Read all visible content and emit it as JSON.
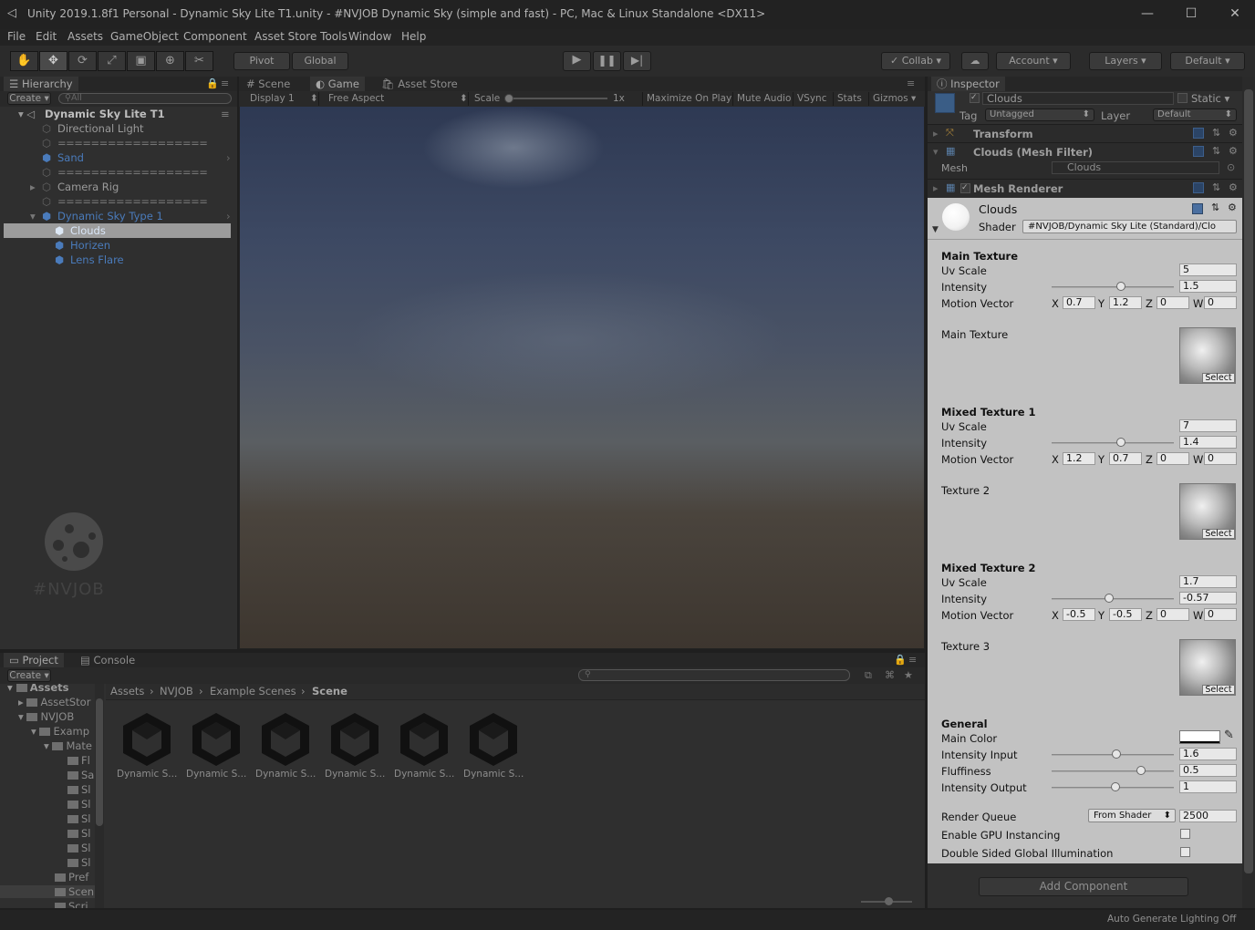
{
  "window": {
    "title": "Unity 2019.1.8f1 Personal - Dynamic Sky Lite T1.unity - #NVJOB Dynamic Sky (simple and fast) - PC, Mac & Linux Standalone <DX11>",
    "minimize": "—",
    "maximize": "☐",
    "close": "✕"
  },
  "menu": [
    "File",
    "Edit",
    "Assets",
    "GameObject",
    "Component",
    "Asset Store Tools",
    "Window",
    "Help"
  ],
  "toolbar": {
    "pivot": "Pivot",
    "global": "Global",
    "collab": "Collab",
    "account": "Account",
    "layers": "Layers",
    "layout": "Default"
  },
  "hierarchy": {
    "tab": "Hierarchy",
    "create": "Create",
    "search_placeholder": "All",
    "scene": "Dynamic Sky Lite T1",
    "items": [
      {
        "label": "Directional Light"
      },
      {
        "label": "=================="
      },
      {
        "label": "Sand"
      },
      {
        "label": "=================="
      },
      {
        "label": "Camera Rig"
      },
      {
        "label": "=================="
      },
      {
        "label": "Dynamic Sky Type 1"
      },
      {
        "label": "Clouds"
      },
      {
        "label": "Horizen"
      },
      {
        "label": "Lens Flare"
      }
    ],
    "watermark": "#NVJOB"
  },
  "game": {
    "tabs": [
      "Scene",
      "Game",
      "Asset Store"
    ],
    "display": "Display 1",
    "aspect": "Free Aspect",
    "scale_label": "Scale",
    "scale_value": "1x",
    "toggles": [
      "Maximize On Play",
      "Mute Audio",
      "VSync",
      "Stats",
      "Gizmos"
    ]
  },
  "project": {
    "tabs": [
      "Project",
      "Console"
    ],
    "create": "Create",
    "tree": [
      "Assets",
      "AssetStor",
      "NVJOB",
      "Examp",
      "Mate",
      "Fl",
      "Sa",
      "Sl",
      "Sl",
      "Sl",
      "Sl",
      "Sl",
      "Sl",
      "Pref",
      "Scen",
      "Scri"
    ],
    "breadcrumb": [
      "Assets",
      "NVJOB",
      "Example Scenes",
      "Scene"
    ],
    "assets": [
      "Dynamic S...",
      "Dynamic S...",
      "Dynamic S...",
      "Dynamic S...",
      "Dynamic S...",
      "Dynamic S..."
    ]
  },
  "inspector": {
    "tab": "Inspector",
    "object_name": "Clouds",
    "static": "Static",
    "tag_label": "Tag",
    "tag_value": "Untagged",
    "layer_label": "Layer",
    "layer_value": "Default",
    "components": {
      "transform": "Transform",
      "mesh_filter": "Clouds (Mesh Filter)",
      "mesh_label": "Mesh",
      "mesh_value": "Clouds",
      "mesh_renderer": "Mesh Renderer"
    },
    "material": {
      "name": "Clouds",
      "shader_label": "Shader",
      "shader_value": "#NVJOB/Dynamic Sky Lite (Standard)/Clo"
    },
    "sections": [
      {
        "title": "Main Texture",
        "uv_scale": "5",
        "intensity": "1.5",
        "intensity_level": 0.57,
        "motion": {
          "x": "0.7",
          "y": "1.2",
          "z": "0",
          "w": "0"
        },
        "texture_label": "Main Texture"
      },
      {
        "title": "Mixed Texture 1",
        "uv_scale": "7",
        "intensity": "1.4",
        "intensity_level": 0.57,
        "motion": {
          "x": "1.2",
          "y": "0.7",
          "z": "0",
          "w": "0"
        },
        "texture_label": "Texture 2"
      },
      {
        "title": "Mixed Texture 2",
        "uv_scale": "1.7",
        "intensity": "-0.57",
        "intensity_level": 0.47,
        "motion": {
          "x": "-0.5",
          "y": "-0.5",
          "z": "0",
          "w": "0"
        },
        "texture_label": "Texture 3"
      }
    ],
    "labels": {
      "uv_scale": "Uv Scale",
      "intensity": "Intensity",
      "motion_vector": "Motion Vector",
      "select": "Select",
      "x": "X",
      "y": "Y",
      "z": "Z",
      "w": "W"
    },
    "general": {
      "title": "General",
      "main_color": "Main Color",
      "intensity_input_label": "Intensity Input",
      "intensity_input": "1.6",
      "intensity_input_level": 0.53,
      "fluffiness_label": "Fluffiness",
      "fluffiness": "0.5",
      "fluffiness_level": 0.73,
      "intensity_output_label": "Intensity Output",
      "intensity_output": "1",
      "intensity_output_level": 0.52,
      "render_queue_label": "Render Queue",
      "render_queue_mode": "From Shader",
      "render_queue": "2500",
      "gpu_instancing": "Enable GPU Instancing",
      "double_sided_gi": "Double Sided Global Illumination"
    },
    "add_component": "Add Component"
  },
  "status": {
    "lighting": "Auto Generate Lighting Off"
  },
  "colors": {
    "overlay_dark": "#2f2f2f",
    "inspector_light": "#c2c2c2",
    "selection_blue": "#4a7bbb"
  }
}
